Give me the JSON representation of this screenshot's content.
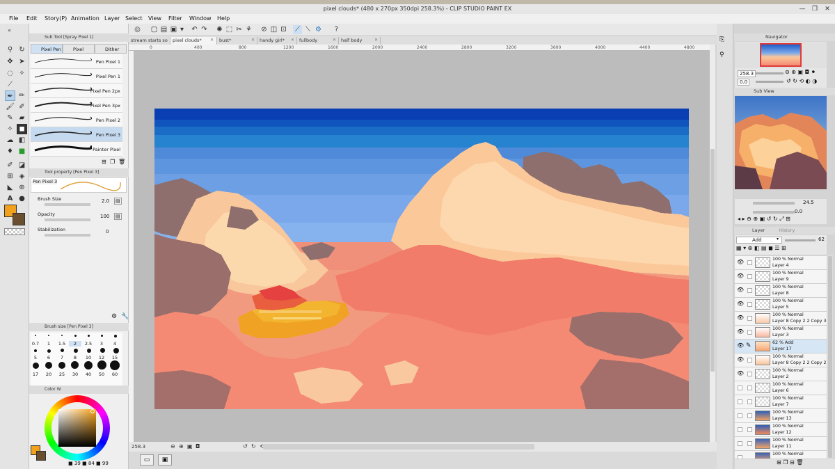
{
  "window": {
    "title": "pixel clouds* (480 x 270px 350dpi 258.3%)  - CLIP STUDIO PAINT EX",
    "min_glyph": "—",
    "max_glyph": "❐",
    "close_glyph": "✕"
  },
  "menu": [
    "File",
    "Edit",
    "Story(P)",
    "Animation",
    "Layer",
    "Select",
    "View",
    "Filter",
    "Window",
    "Help"
  ],
  "tabs": [
    {
      "label": "stream starts so",
      "active": false
    },
    {
      "label": "pixel clouds*",
      "active": true
    },
    {
      "label": "bust*",
      "active": false
    },
    {
      "label": "handy girl*",
      "active": false
    },
    {
      "label": "fullbody",
      "active": false
    },
    {
      "label": "half body",
      "active": false
    }
  ],
  "ruler_marks": [
    "0",
    "400",
    "800",
    "1200",
    "1600",
    "2000",
    "2400",
    "2800",
    "3200",
    "3600",
    "4000",
    "4400",
    "4800"
  ],
  "subtool": {
    "header": "Sub Tool [Spray Pixel 1]",
    "tabs": [
      {
        "label": "Pixel Pen",
        "selected": true
      },
      {
        "label": "Pixel spra",
        "selected": false
      },
      {
        "label": "Dither",
        "selected": false
      }
    ],
    "brushes": [
      {
        "name": "Pen Pixel 1",
        "selected": false
      },
      {
        "name": "Pixel Pen 1",
        "selected": false
      },
      {
        "name": "Pixel Pen 2px",
        "selected": false
      },
      {
        "name": "Pixel Pen 3px",
        "selected": false
      },
      {
        "name": "Pen Pixel 2",
        "selected": false
      },
      {
        "name": "Pen Pixel 3",
        "selected": true
      },
      {
        "name": "Painter Pixel",
        "selected": false
      }
    ]
  },
  "toolprop": {
    "header": "Tool property [Pen Pixel 3]",
    "preview_name": "Pen Pixel 3",
    "brush_size_label": "Brush Size",
    "brush_size_value": "2.0",
    "opacity_label": "Opacity",
    "opacity_value": "100",
    "stab_label": "Stabilization",
    "stab_value": "0"
  },
  "brushsize": {
    "header": "Brush size [Pen Pixel 3]",
    "row1": [
      "0.7",
      "1",
      "1.5",
      "2",
      "2.5",
      "3",
      "4"
    ],
    "row2": [
      "5",
      "6",
      "7",
      "8",
      "10",
      "12",
      "15"
    ],
    "row3": [
      "17",
      "20",
      "25",
      "30",
      "40",
      "50",
      "60"
    ]
  },
  "color": {
    "header": "Color W",
    "main": "#F2A11C",
    "sub": "#6B4E2E",
    "readout_h": "39",
    "readout_s": "84",
    "readout_v": "99"
  },
  "navigator": {
    "header": "Navigator",
    "zoom": "258.3",
    "rotation": "0.0"
  },
  "subview": {
    "header": "Sub View",
    "zoom": "24.5",
    "rotation": "0.0"
  },
  "layerpanel": {
    "tab_layer": "Layer",
    "tab_history": "History",
    "blend_mode": "Add",
    "opacity": "62",
    "layers": [
      {
        "blend": "100 % Normal",
        "name": "Layer 4",
        "eye": true,
        "selected": false,
        "thumb": "checker"
      },
      {
        "blend": "100 % Normal",
        "name": "Layer 9",
        "eye": true,
        "selected": false,
        "thumb": "checker"
      },
      {
        "blend": "100 % Normal",
        "name": "Layer 8",
        "eye": true,
        "selected": false,
        "thumb": "checker"
      },
      {
        "blend": "100 % Normal",
        "name": "Layer 5",
        "eye": true,
        "selected": false,
        "thumb": "checker"
      },
      {
        "blend": "100 % Normal",
        "name": "Layer 8 Copy 2 2 Copy 3",
        "eye": true,
        "selected": false,
        "thumb": "checker"
      },
      {
        "blend": "100 % Normal",
        "name": "Layer 3",
        "eye": true,
        "selected": false,
        "thumb": "checker"
      },
      {
        "blend": "62 % Add",
        "name": "Layer 17",
        "eye": true,
        "selected": true,
        "thumb": "warm"
      },
      {
        "blend": "100 % Normal",
        "name": "Layer 8 Copy 2 2 Copy 2",
        "eye": true,
        "selected": false,
        "thumb": "checker"
      },
      {
        "blend": "100 % Normal",
        "name": "Layer 2",
        "eye": true,
        "selected": false,
        "thumb": "checker"
      },
      {
        "blend": "100 % Normal",
        "name": "Layer 6",
        "eye": false,
        "selected": false,
        "thumb": "checker"
      },
      {
        "blend": "100 % Normal",
        "name": "Layer 7",
        "eye": false,
        "selected": false,
        "thumb": "checker"
      },
      {
        "blend": "100 % Normal",
        "name": "Layer 13",
        "eye": false,
        "selected": false,
        "thumb": "sunset"
      },
      {
        "blend": "100 % Normal",
        "name": "Layer 12",
        "eye": false,
        "selected": false,
        "thumb": "sunset"
      },
      {
        "blend": "100 % Normal",
        "name": "Layer 11",
        "eye": false,
        "selected": false,
        "thumb": "sunset"
      },
      {
        "blend": "100 % Normal",
        "name": "",
        "eye": false,
        "selected": false,
        "thumb": "sunset"
      }
    ]
  },
  "status": {
    "zoom": "258.3"
  }
}
